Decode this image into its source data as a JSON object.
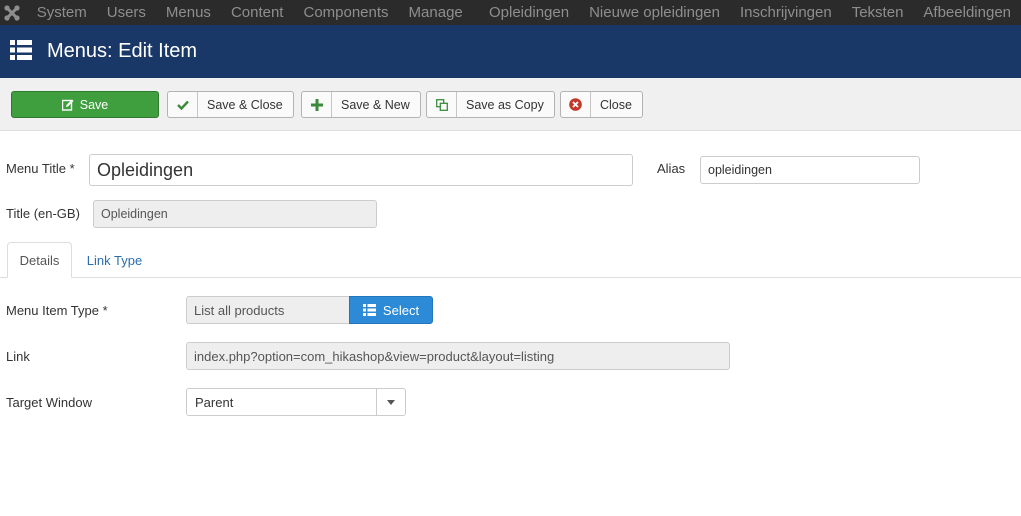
{
  "topnav": {
    "logo_icon": "joomla-logo-icon",
    "items": [
      "System",
      "Users",
      "Menus",
      "Content",
      "Components",
      "Manage",
      "Opleidingen",
      "Nieuwe opleidingen",
      "Inschrijvingen",
      "Teksten",
      "Afbeeldingen"
    ]
  },
  "header": {
    "icon": "list-icon",
    "title": "Menus: Edit Item"
  },
  "toolbar": {
    "save": "Save",
    "save_close": "Save & Close",
    "save_new": "Save & New",
    "save_copy": "Save as Copy",
    "close": "Close"
  },
  "form": {
    "menu_title_label": "Menu Title *",
    "menu_title_value": "Opleidingen",
    "alias_label": "Alias",
    "alias_value": "opleidingen",
    "title_en_label": "Title (en-GB)",
    "title_en_value": "Opleidingen"
  },
  "tabs": [
    "Details",
    "Link Type"
  ],
  "details": {
    "menu_item_type_label": "Menu Item Type *",
    "menu_item_type_value": "List all products",
    "select_button": "Select",
    "link_label": "Link",
    "link_value": "index.php?option=com_hikashop&view=product&layout=listing",
    "target_window_label": "Target Window",
    "target_window_value": "Parent"
  },
  "colors": {
    "topnav_bg": "#2b2b2b",
    "header_bg": "#1a3867",
    "save_green": "#3f9f3f",
    "select_blue": "#2d8ad6",
    "link_blue": "#2a6fb0"
  }
}
